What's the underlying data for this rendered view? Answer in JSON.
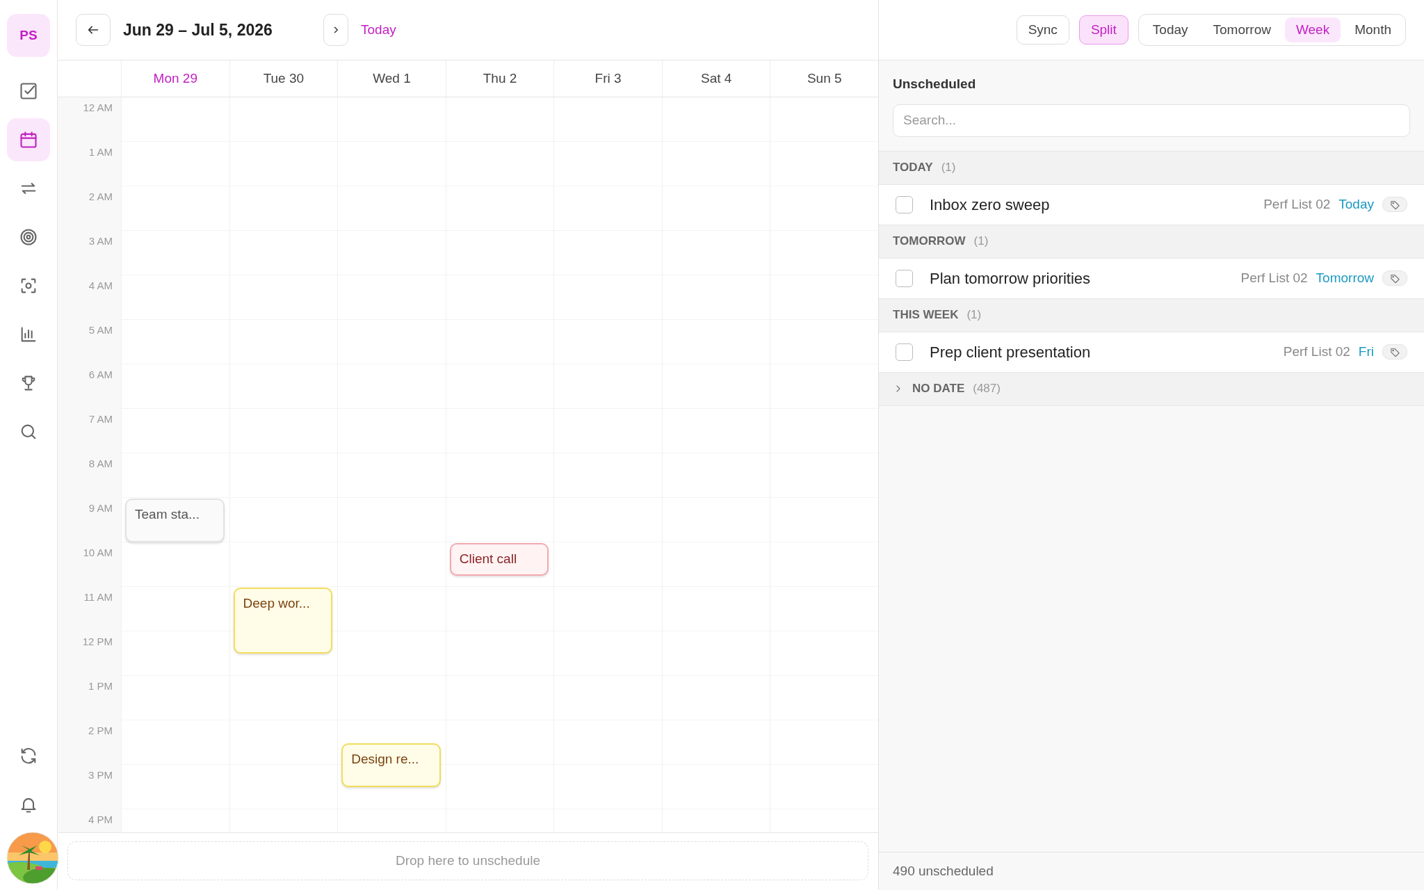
{
  "sidebar": {
    "avatar": "PS",
    "items": [
      {
        "selected": false
      },
      {
        "selected": true
      },
      {
        "selected": false
      },
      {
        "selected": false
      },
      {
        "selected": false
      },
      {
        "selected": false
      },
      {
        "selected": false
      },
      {
        "selected": false
      }
    ],
    "bottom_items": [
      {
        "selected": false
      },
      {
        "selected": false
      }
    ]
  },
  "toolbar": {
    "range_title": "Jun 29 – Jul 5, 2026",
    "today_link": "Today",
    "sync_button": "Sync",
    "split_toggle": {
      "label": "Split",
      "selected": true
    },
    "views": [
      {
        "label": "Today",
        "selected": false
      },
      {
        "label": "Tomorrow",
        "selected": false
      },
      {
        "label": "Week",
        "selected": true
      },
      {
        "label": "Month",
        "selected": false
      }
    ]
  },
  "calendar": {
    "days": [
      {
        "label": "Mon 29",
        "is_today": true,
        "events": [
          {
            "title": "Team sta...",
            "kind": "neutral"
          }
        ]
      },
      {
        "label": "Tue 30",
        "is_today": false,
        "events": [
          {
            "title": "Deep wor...",
            "kind": "yellow"
          }
        ]
      },
      {
        "label": "Wed 1",
        "is_today": false,
        "events": [
          {
            "title": "Design re...",
            "kind": "yellow"
          }
        ]
      },
      {
        "label": "Thu 2",
        "is_today": false,
        "events": [
          {
            "title": "Client call",
            "kind": "red"
          }
        ]
      },
      {
        "label": "Fri 3",
        "is_today": false
      },
      {
        "label": "Sat 4",
        "is_today": false
      },
      {
        "label": "Sun 5",
        "is_today": false
      }
    ],
    "hours": [
      "12 AM",
      "1 AM",
      "2 AM",
      "3 AM",
      "4 AM",
      "5 AM",
      "6 AM",
      "7 AM",
      "8 AM",
      "9 AM",
      "10 AM",
      "11 AM",
      "12 PM",
      "1 PM",
      "2 PM",
      "3 PM",
      "4 PM"
    ],
    "drop_zone": "Drop here to unschedule"
  },
  "unscheduled": {
    "title": "Unscheduled",
    "search": {
      "placeholder": "Search..."
    },
    "groups": [
      {
        "title": "TODAY",
        "count": "(1)",
        "expanded": true,
        "tasks": [
          {
            "title": "Inbox zero sweep",
            "list": "Perf List 02",
            "due": "Today",
            "checked": false
          }
        ]
      },
      {
        "title": "TOMORROW",
        "count": "(1)",
        "expanded": true,
        "tasks": [
          {
            "title": "Plan tomorrow priorities",
            "list": "Perf List 02",
            "due": "Tomorrow",
            "checked": false
          }
        ]
      },
      {
        "title": "THIS WEEK",
        "count": "(1)",
        "expanded": true,
        "tasks": [
          {
            "title": "Prep client presentation",
            "list": "Perf List 02",
            "due": "Fri",
            "checked": false
          }
        ]
      },
      {
        "title": "NO DATE",
        "count": "(487)",
        "expanded": false
      }
    ],
    "footer": "490 unscheduled"
  }
}
